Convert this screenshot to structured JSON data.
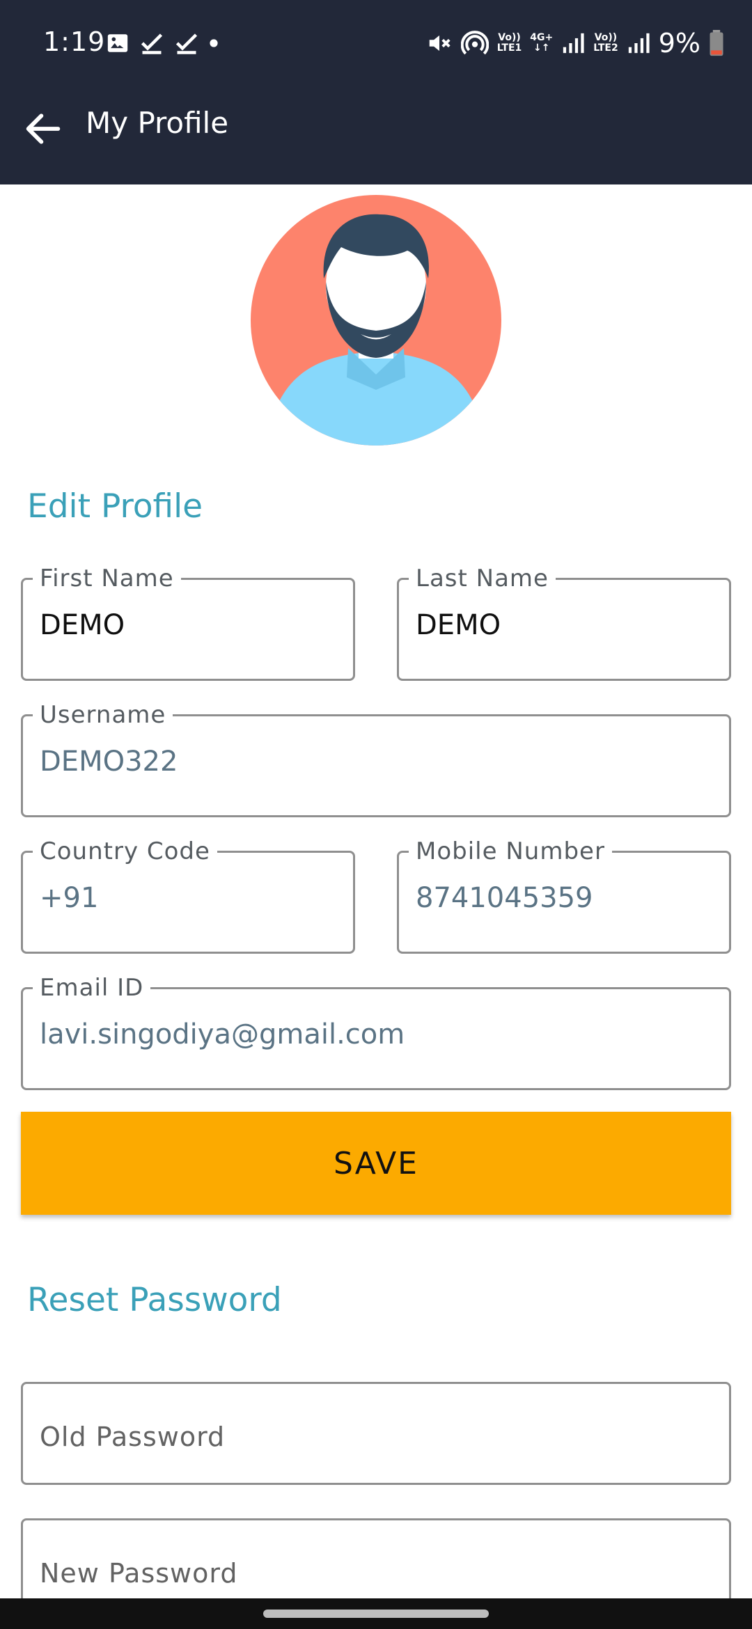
{
  "status_bar": {
    "time": "1:19",
    "battery": "9%",
    "network_labels": [
      "Vo)) LTE1",
      "4G+",
      "Vo)) LTE2"
    ],
    "icons": [
      "image-icon",
      "check-icon",
      "check-icon",
      "dot-icon",
      "mute-icon",
      "hotspot-icon",
      "signal-icon",
      "signal-icon",
      "battery-icon"
    ]
  },
  "app_bar": {
    "title": "My Profile",
    "back_icon": "arrow-back-icon"
  },
  "edit_profile": {
    "section_title": "Edit Profile",
    "first_name": {
      "label": "First Name",
      "value": "DEMO"
    },
    "last_name": {
      "label": "Last Name",
      "value": "DEMO"
    },
    "username": {
      "label": "Username",
      "value": "DEMO322"
    },
    "country_code": {
      "label": "Country Code",
      "value": "+91"
    },
    "mobile_number": {
      "label": "Mobile Number",
      "value": "8741045359"
    },
    "email": {
      "label": "Email ID",
      "value": "lavi.singodiya@gmail.com"
    },
    "save_label": "SAVE"
  },
  "reset_password": {
    "section_title": "Reset Password",
    "old_password_placeholder": "Old Password",
    "new_password_placeholder": "New Password"
  },
  "colors": {
    "header_bg": "#222839",
    "accent_teal": "#3aa0b8",
    "save_button": "#fcaa00",
    "avatar_bg": "#fd836c",
    "avatar_shirt": "#87d8fb"
  }
}
